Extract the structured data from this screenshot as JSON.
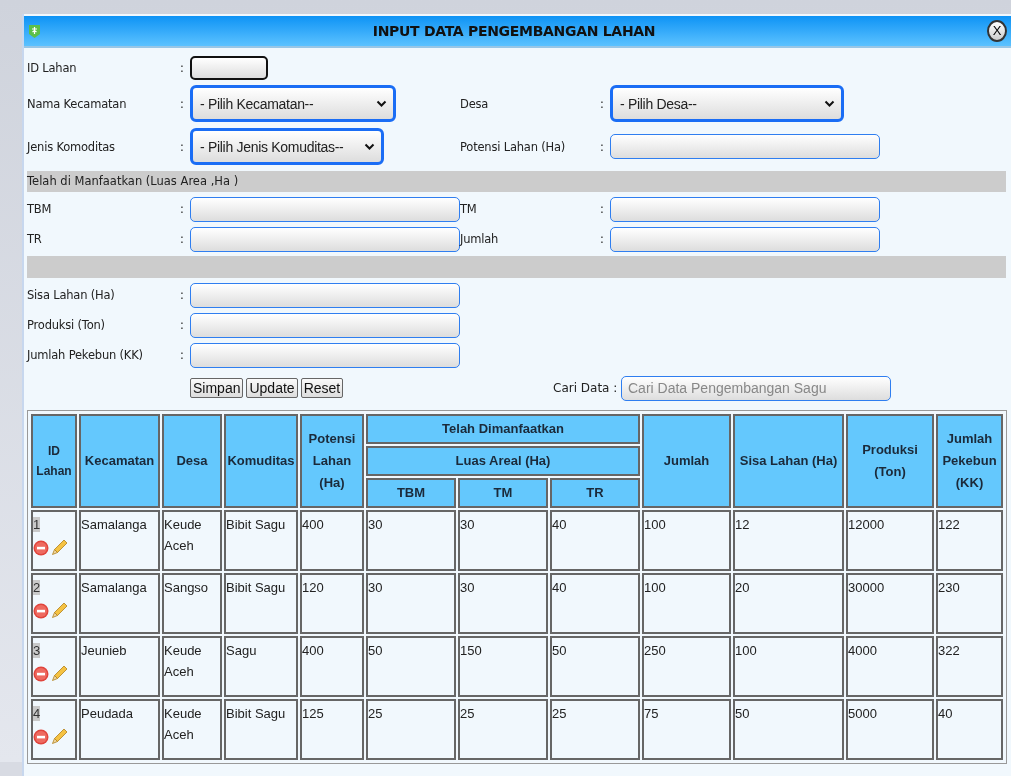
{
  "window": {
    "title": "INPUT DATA PENGEMBANGAN LAHAN",
    "close_label": "X"
  },
  "form": {
    "items": [
      {
        "kind": "row",
        "fields": [
          {
            "kind": "short_text",
            "label": "ID Lahan",
            "separator": ":"
          }
        ]
      },
      {
        "kind": "row",
        "fields": [
          {
            "kind": "select",
            "label": "Nama Kecamatan",
            "separator": ":",
            "value": "- Pilih Kecamatan--"
          },
          {
            "kind": "select",
            "label": "Desa",
            "separator": ":",
            "value": "- Pilih Desa--"
          }
        ]
      },
      {
        "kind": "row",
        "fields": [
          {
            "kind": "select",
            "label": "Jenis Komoditas",
            "separator": ":",
            "value": "- Pilih Jenis Komuditas--"
          },
          {
            "kind": "text",
            "label": "Potensi Lahan (Ha)",
            "separator": ":"
          }
        ]
      },
      {
        "kind": "section",
        "title": "Telah di Manfaatkan (Luas Area ,Ha )"
      },
      {
        "kind": "row",
        "fields": [
          {
            "kind": "text",
            "label": "TBM",
            "separator": ":"
          },
          {
            "kind": "text",
            "label": "TM",
            "separator": ":"
          }
        ]
      },
      {
        "kind": "row",
        "fields": [
          {
            "kind": "text",
            "label": "TR",
            "separator": ":"
          },
          {
            "kind": "text",
            "label": "Jumlah",
            "separator": ":"
          }
        ]
      },
      {
        "kind": "divider"
      },
      {
        "kind": "row",
        "fields": [
          {
            "kind": "text",
            "label": "Sisa Lahan (Ha)",
            "separator": ":"
          }
        ]
      },
      {
        "kind": "row",
        "fields": [
          {
            "kind": "text",
            "label": "Produksi (Ton)",
            "separator": ":"
          }
        ]
      },
      {
        "kind": "row",
        "fields": [
          {
            "kind": "text",
            "label": "Jumlah Pekebun (KK)",
            "separator": ":"
          }
        ]
      }
    ],
    "buttons": [
      "Simpan",
      "Update",
      "Reset"
    ],
    "search": {
      "label": "Cari Data :",
      "placeholder": "Cari Data Pengembangan Sagu"
    }
  },
  "table": {
    "columns": [
      {
        "label": "ID Lahan"
      },
      {
        "label": "Kecamatan"
      },
      {
        "label": "Desa"
      },
      {
        "label": "Komuditas"
      },
      {
        "label": "Potensi Lahan (Ha)"
      },
      {
        "label": "Telah Dimanfaatkan",
        "colspan": 3,
        "children": [
          {
            "label": "Luas Areal (Ha)",
            "colspan": 3,
            "children": [
              {
                "label": "TBM"
              },
              {
                "label": "TM"
              },
              {
                "label": "TR"
              }
            ]
          }
        ]
      },
      {
        "label": "Jumlah"
      },
      {
        "label": "Sisa Lahan (Ha)"
      },
      {
        "label": "Produksi (Ton)"
      },
      {
        "label": "Jumlah Pekebun (KK)"
      }
    ],
    "rows": [
      {
        "cells": [
          "1",
          "Samalanga",
          "Keude Aceh",
          "Bibit Sagu",
          "400",
          "30",
          "30",
          "40",
          "100",
          "12",
          "12000",
          "122"
        ]
      },
      {
        "cells": [
          "2",
          "Samalanga",
          "Sangso",
          "Bibit Sagu",
          "120",
          "30",
          "30",
          "40",
          "100",
          "20",
          "30000",
          "230"
        ]
      },
      {
        "cells": [
          "3",
          "Jeunieb",
          "Keude Aceh",
          "Sagu",
          "400",
          "50",
          "150",
          "50",
          "250",
          "100",
          "4000",
          "322"
        ]
      },
      {
        "cells": [
          "4",
          "Peudada",
          "Keude Aceh",
          "Bibit Sagu",
          "125",
          "25",
          "25",
          "25",
          "75",
          "50",
          "5000",
          "40"
        ]
      }
    ]
  }
}
